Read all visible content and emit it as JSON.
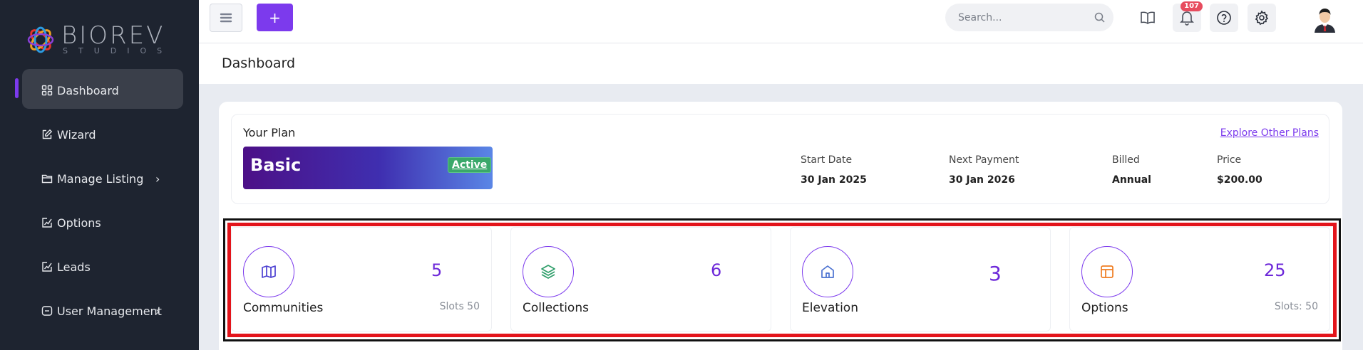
{
  "brand": {
    "name": "BIOREV",
    "sub": "STUDIOS"
  },
  "sidebar": {
    "items": [
      {
        "label": "Dashboard",
        "icon": "grid-icon",
        "active": true
      },
      {
        "label": "Wizard",
        "icon": "edit-icon"
      },
      {
        "label": "Manage Listing",
        "icon": "folder-icon",
        "has_children": true
      },
      {
        "label": "Options",
        "icon": "chart-box-icon"
      },
      {
        "label": "Leads",
        "icon": "chart-box-icon"
      },
      {
        "label": "User Management",
        "icon": "user-box-icon",
        "has_children": true
      }
    ]
  },
  "topbar": {
    "add_label": "+",
    "search_placeholder": "Search...",
    "notification_count": "107"
  },
  "page": {
    "title": "Dashboard"
  },
  "plan": {
    "heading": "Your Plan",
    "name": "Basic",
    "status": "Active",
    "explore_link": "Explore Other Plans",
    "fields": [
      {
        "label": "Start Date",
        "value": "30 Jan 2025"
      },
      {
        "label": "Next Payment",
        "value": "30 Jan 2026"
      },
      {
        "label": "Billed",
        "value": "Annual"
      },
      {
        "label": "Price",
        "value": "$200.00"
      }
    ]
  },
  "stats": [
    {
      "label": "Communities",
      "value": "5",
      "slots": "Slots 50",
      "icon": "map-icon",
      "icon_color": "#4b3fd1"
    },
    {
      "label": "Collections",
      "value": "6",
      "slots": "",
      "icon": "layers-icon",
      "icon_color": "#2f9e6a"
    },
    {
      "label": "Elevation",
      "value": "3",
      "slots": "",
      "icon": "home-icon",
      "icon_color": "#4b72d1"
    },
    {
      "label": "Options",
      "value": "25",
      "slots": "Slots: 50",
      "icon": "layout-icon",
      "icon_color": "#ef7d22"
    }
  ],
  "colors": {
    "accent": "#7c3aed",
    "sidebar_bg": "#1e2430",
    "highlight": "#e3141b",
    "badge": "#e74c5e"
  }
}
